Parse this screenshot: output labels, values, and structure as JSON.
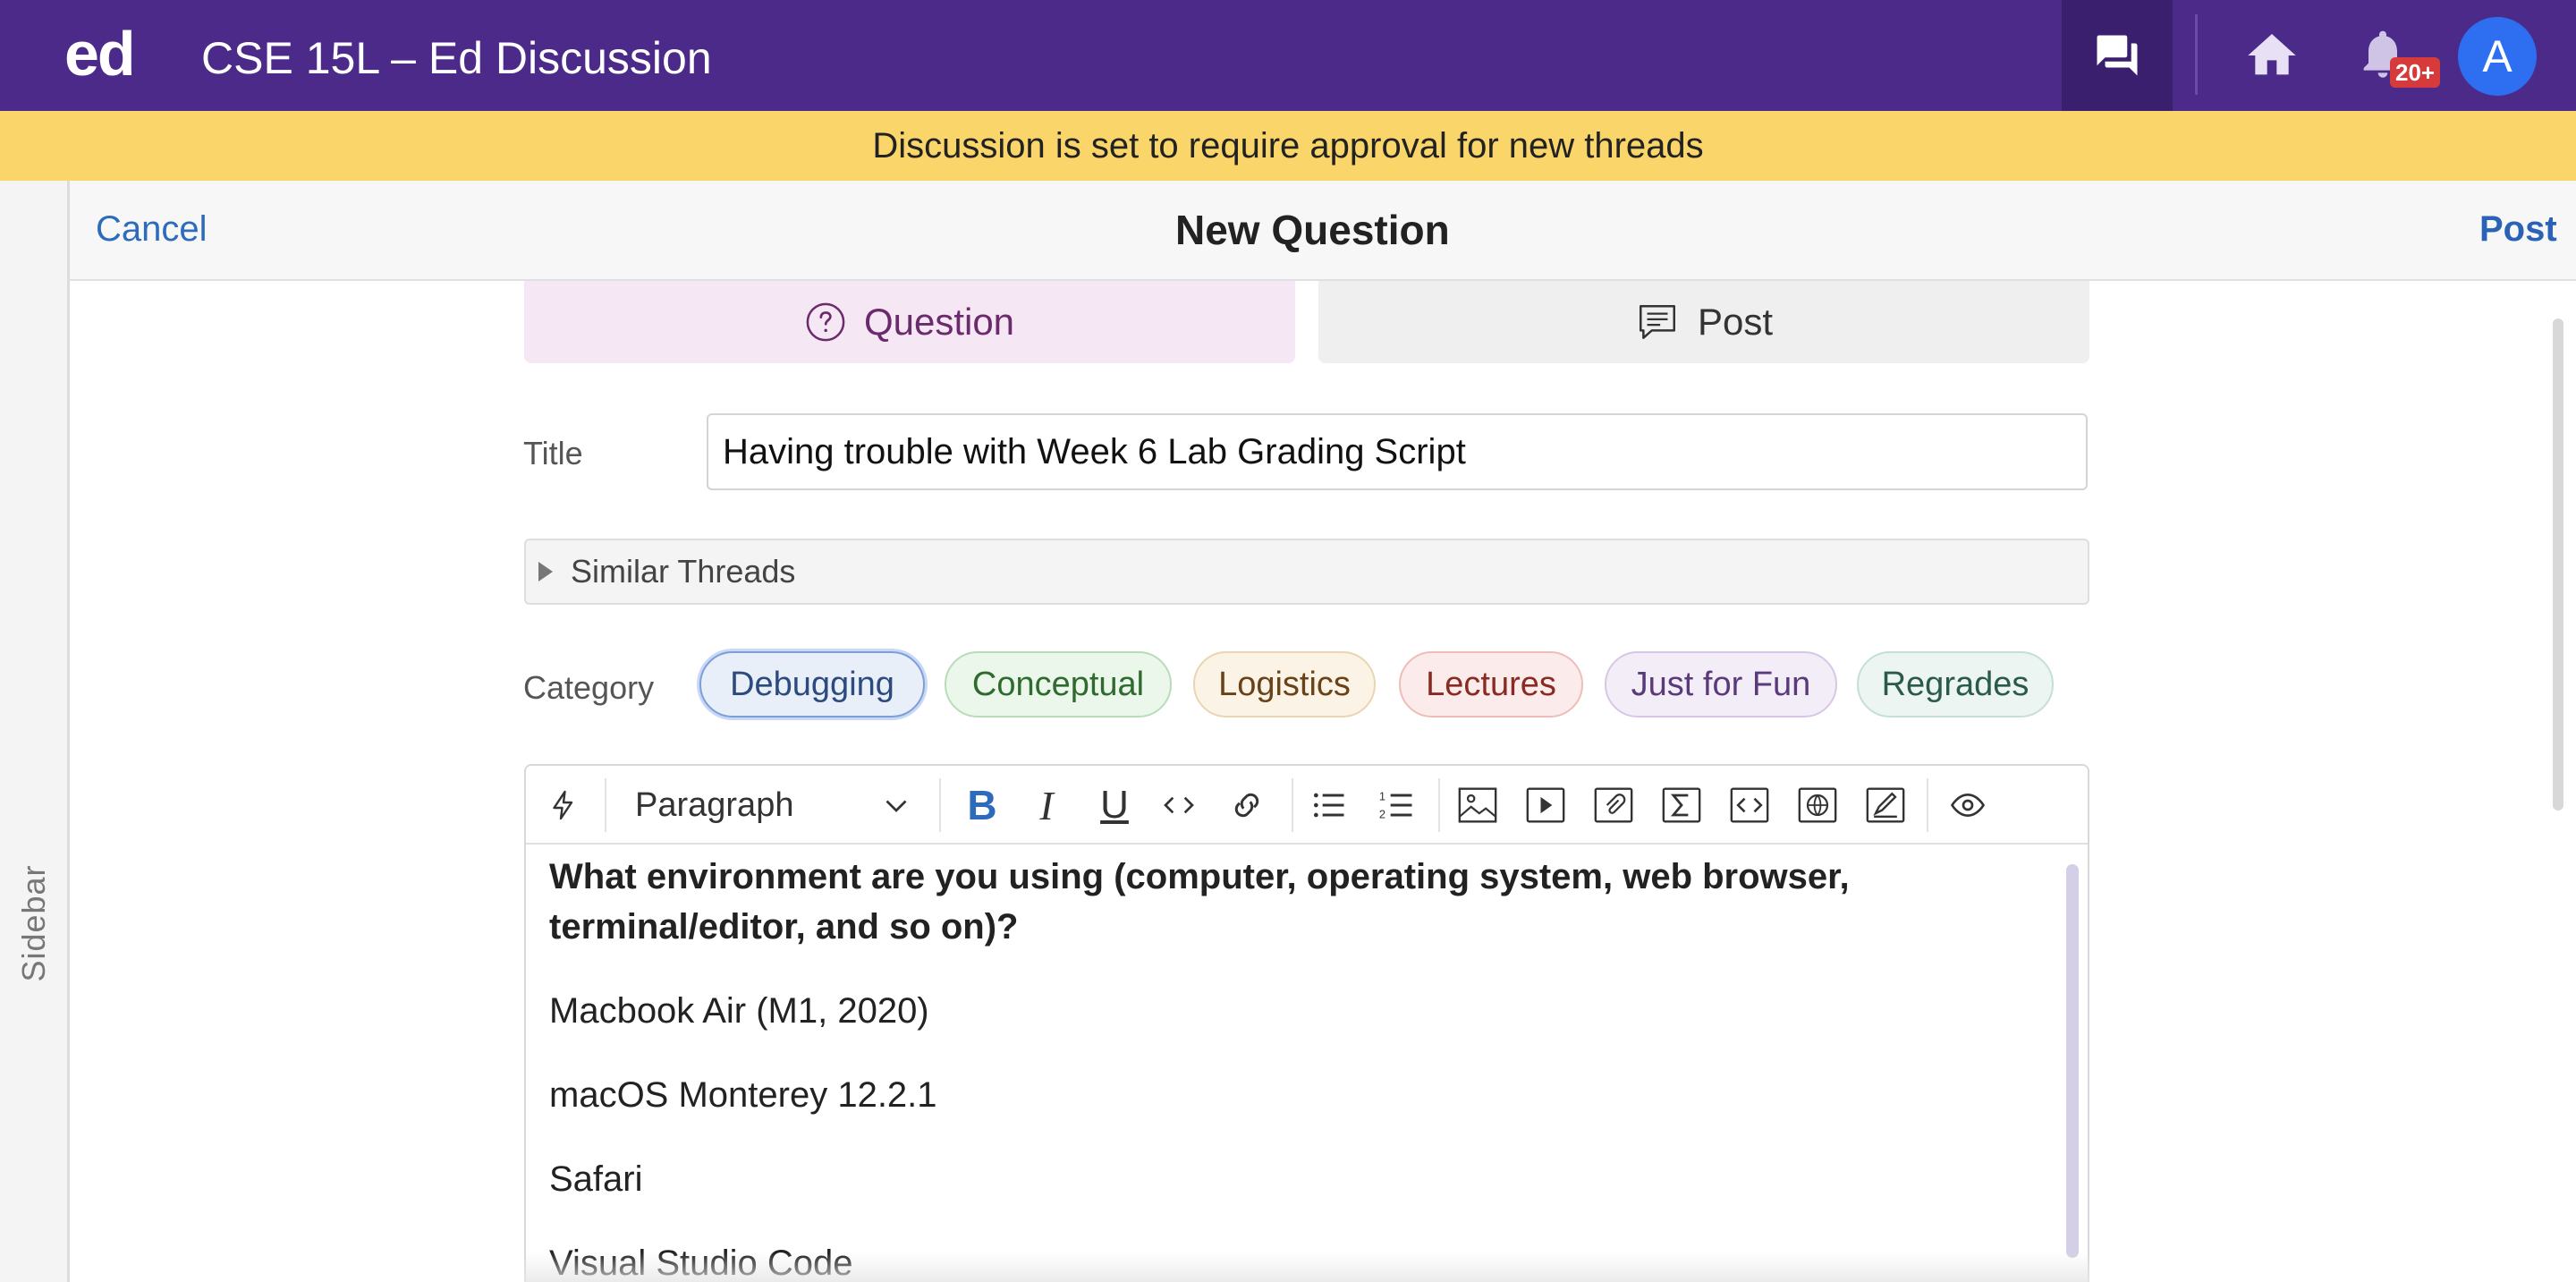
{
  "header": {
    "logo": "ed",
    "course_title": "CSE 15L – Ed Discussion",
    "notifications_badge": "20+",
    "avatar_initial": "A"
  },
  "banner": {
    "text": "Discussion is set to require approval for new threads"
  },
  "sidebar": {
    "label": "Sidebar"
  },
  "composer": {
    "cancel_label": "Cancel",
    "title": "New Question",
    "post_label": "Post",
    "types": [
      {
        "label": "Question",
        "icon": "question-circle-icon",
        "selected": true
      },
      {
        "label": "Post",
        "icon": "comment-icon",
        "selected": false
      }
    ],
    "title_label": "Title",
    "title_value": "Having trouble with Week 6 Lab Grading Script",
    "similar_threads_label": "Similar Threads",
    "category_label": "Category",
    "categories": [
      {
        "label": "Debugging",
        "selected": true
      },
      {
        "label": "Conceptual",
        "selected": false
      },
      {
        "label": "Logistics",
        "selected": false
      },
      {
        "label": "Lectures",
        "selected": false
      },
      {
        "label": "Just for Fun",
        "selected": false
      },
      {
        "label": "Regrades",
        "selected": false
      }
    ]
  },
  "editor": {
    "paragraph_style": "Paragraph",
    "toolbar_icons": [
      "lightning-icon",
      "bold-icon",
      "italic-icon",
      "underline-icon",
      "code-icon",
      "link-icon",
      "bullet-list-icon",
      "numbered-list-icon",
      "image-icon",
      "video-icon",
      "attachment-icon",
      "math-icon",
      "code-block-icon",
      "web-snippet-icon",
      "drawing-icon",
      "preview-icon"
    ],
    "content": {
      "question": "What environment are you using (computer, operating system, web browser, terminal/editor, and so on)?",
      "lines": [
        "Macbook Air (M1, 2020)",
        "macOS Monterey 12.2.1",
        "Safari",
        "Visual Studio Code"
      ]
    }
  },
  "colors": {
    "header_bg": "#4b2a8a",
    "banner_bg": "#f9d56a",
    "link_blue": "#2d6bbd",
    "question_tab_bg": "#f5e7f4"
  }
}
